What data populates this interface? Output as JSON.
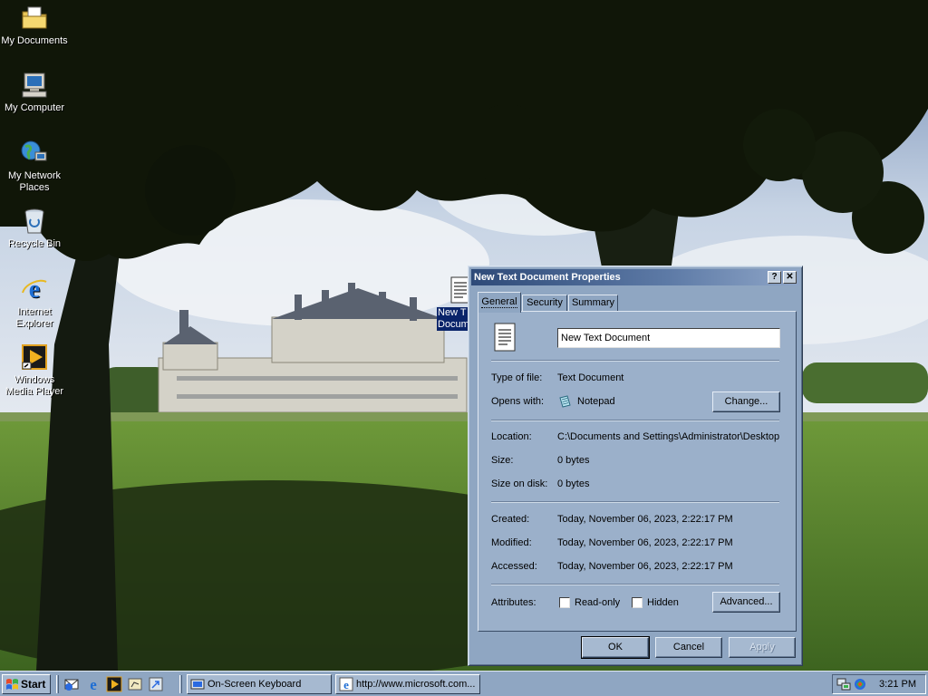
{
  "desktop": {
    "icons": [
      {
        "label": "My Documents",
        "icon": "folder-documents-icon"
      },
      {
        "label": "My Computer",
        "icon": "computer-icon"
      },
      {
        "label": "My Network Places",
        "label_line1": "My Network",
        "label_line2": "Places",
        "icon": "network-places-icon"
      },
      {
        "label": "Recycle Bin",
        "icon": "recycle-bin-icon"
      },
      {
        "label": "Internet Explorer",
        "label_line1": "Internet",
        "label_line2": "Explorer",
        "icon": "internet-explorer-icon"
      },
      {
        "label": "Windows Media Player",
        "label_line1": "Windows",
        "label_line2": "Media Player",
        "icon": "media-player-icon"
      }
    ],
    "selected_file": {
      "label_line1": "New T",
      "label_line2": "Docum",
      "icon": "text-document-icon"
    }
  },
  "dialog": {
    "title": "New Text Document Properties",
    "help_glyph": "?",
    "close_glyph": "✕",
    "tabs": [
      {
        "label": "General",
        "active": true
      },
      {
        "label": "Security",
        "active": false
      },
      {
        "label": "Summary",
        "active": false
      }
    ],
    "general": {
      "file_name": "New Text Document",
      "type_label": "Type of file:",
      "type_value": "Text Document",
      "opens_label": "Opens with:",
      "opens_value": "Notepad",
      "change_button": "Change...",
      "location_label": "Location:",
      "location_value": "C:\\Documents and Settings\\Administrator\\Desktop",
      "size_label": "Size:",
      "size_value": "0 bytes",
      "size_on_disk_label": "Size on disk:",
      "size_on_disk_value": "0 bytes",
      "created_label": "Created:",
      "created_value": "Today, November 06, 2023, 2:22:17 PM",
      "modified_label": "Modified:",
      "modified_value": "Today, November 06, 2023, 2:22:17 PM",
      "accessed_label": "Accessed:",
      "accessed_value": "Today, November 06, 2023, 2:22:17 PM",
      "attributes_label": "Attributes:",
      "readonly_label": "Read-only",
      "readonly_checked": false,
      "hidden_label": "Hidden",
      "hidden_checked": false,
      "advanced_button": "Advanced..."
    },
    "buttons": {
      "ok": "OK",
      "cancel": "Cancel",
      "apply": "Apply"
    }
  },
  "taskbar": {
    "start_label": "Start",
    "quick_launch": [
      "outlook-express-icon",
      "internet-explorer-icon",
      "media-player-icon",
      "desktop-icon",
      "shortcut-icon"
    ],
    "tasks": [
      {
        "label": "On-Screen Keyboard",
        "icon": "keyboard-icon"
      },
      {
        "label": "http://www.microsoft.com...",
        "icon": "internet-explorer-icon"
      }
    ],
    "tray_icons": [
      "network-icon",
      "volume-icon"
    ],
    "clock": "3:21 PM"
  },
  "colors": {
    "dialog_face": "#8fa6c2",
    "title_gradient_start": "#2e4a78",
    "title_gradient_end": "#8fa6c8",
    "selection": "#0a246a"
  }
}
